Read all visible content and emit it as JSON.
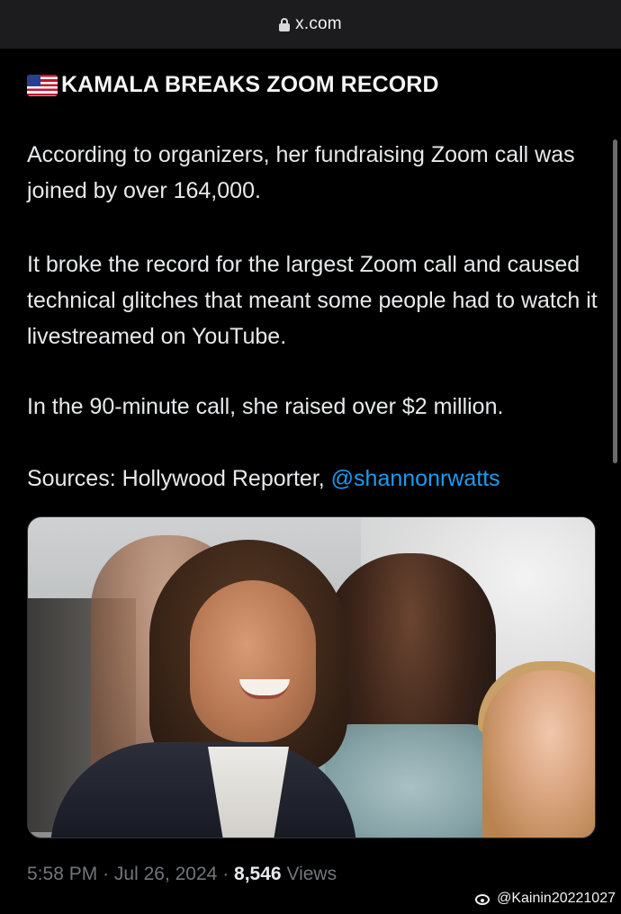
{
  "browser": {
    "url": "x.com"
  },
  "post": {
    "headline": "KAMALA BREAKS ZOOM RECORD",
    "paragraph_1": "According to organizers, her fundraising Zoom call was joined by over 164,000.",
    "paragraph_2": "It broke the record for the largest Zoom call and caused technical glitches that meant some people had to watch it livestreamed on YouTube.",
    "paragraph_3": "In the 90-minute call, she raised over $2 million.",
    "sources_prefix": "Sources: Hollywood Reporter, ",
    "sources_mention": "@shannonrwatts",
    "time": "5:58 PM",
    "separator": "·",
    "date": "Jul 26, 2024",
    "views_count": "8,546",
    "views_label": "Views"
  },
  "watermark": {
    "handle": "@Kainin20221027"
  },
  "colors": {
    "background": "#000000",
    "link": "#1d9bf0",
    "muted": "#71767b",
    "text": "#e7e9ea"
  }
}
